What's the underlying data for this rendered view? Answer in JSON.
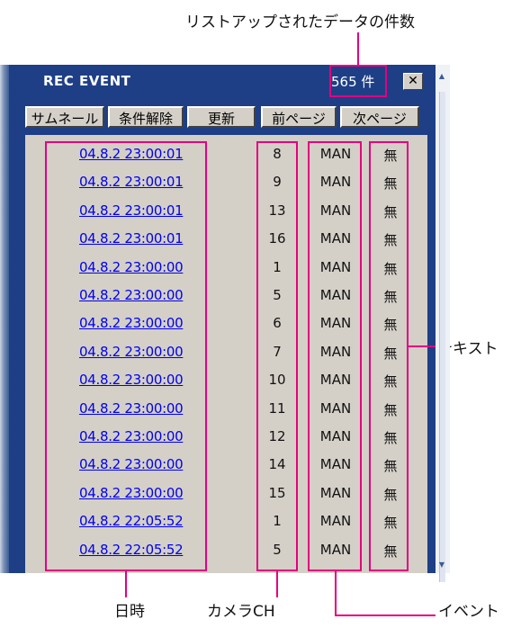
{
  "callouts": {
    "count": "リストアップされたデータの件数",
    "text": "テキスト",
    "datetime": "日時",
    "camera": "カメラCH",
    "event": "イベント"
  },
  "window": {
    "title": "REC EVENT",
    "count": "565 件",
    "close": "✕"
  },
  "toolbar": {
    "thumbnail": "サムネール",
    "clear": "条件解除",
    "refresh": "更新",
    "prev": "前ページ",
    "next": "次ページ"
  },
  "rows": [
    {
      "date": "04.8.2 23:00:01",
      "ch": "8",
      "event": "MAN",
      "text": "無"
    },
    {
      "date": "04.8.2 23:00:01",
      "ch": "9",
      "event": "MAN",
      "text": "無"
    },
    {
      "date": "04.8.2 23:00:01",
      "ch": "13",
      "event": "MAN",
      "text": "無"
    },
    {
      "date": "04.8.2 23:00:01",
      "ch": "16",
      "event": "MAN",
      "text": "無"
    },
    {
      "date": "04.8.2 23:00:00",
      "ch": "1",
      "event": "MAN",
      "text": "無"
    },
    {
      "date": "04.8.2 23:00:00",
      "ch": "5",
      "event": "MAN",
      "text": "無"
    },
    {
      "date": "04.8.2 23:00:00",
      "ch": "6",
      "event": "MAN",
      "text": "無"
    },
    {
      "date": "04.8.2 23:00:00",
      "ch": "7",
      "event": "MAN",
      "text": "無"
    },
    {
      "date": "04.8.2 23:00:00",
      "ch": "10",
      "event": "MAN",
      "text": "無"
    },
    {
      "date": "04.8.2 23:00:00",
      "ch": "11",
      "event": "MAN",
      "text": "無"
    },
    {
      "date": "04.8.2 23:00:00",
      "ch": "12",
      "event": "MAN",
      "text": "無"
    },
    {
      "date": "04.8.2 23:00:00",
      "ch": "14",
      "event": "MAN",
      "text": "無"
    },
    {
      "date": "04.8.2 23:00:00",
      "ch": "15",
      "event": "MAN",
      "text": "無"
    },
    {
      "date": "04.8.2 22:05:52",
      "ch": "1",
      "event": "MAN",
      "text": "無"
    },
    {
      "date": "04.8.2 22:05:52",
      "ch": "5",
      "event": "MAN",
      "text": "無"
    }
  ],
  "colors": {
    "annotation": "#e4007f",
    "titlebar": "#1e3f86",
    "link": "#0000ee",
    "list_bg": "#d4d0c8"
  }
}
